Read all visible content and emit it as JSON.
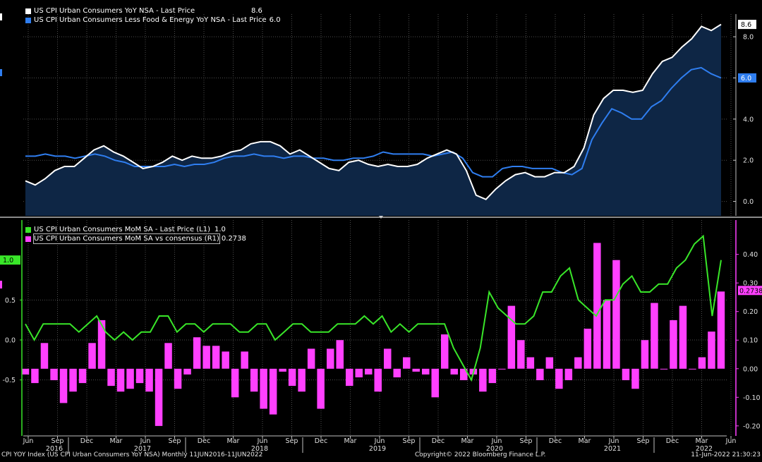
{
  "chart_data": [
    {
      "type": "area",
      "panel": "top",
      "series": [
        {
          "name": "US CPI Urban Consumers YoY NSA - Last Price",
          "last": "8.6",
          "color": "#ffffff",
          "values": [
            1.0,
            0.8,
            1.1,
            1.5,
            1.7,
            1.7,
            2.1,
            2.5,
            2.7,
            2.4,
            2.2,
            1.9,
            1.6,
            1.7,
            1.9,
            2.2,
            2.0,
            2.2,
            2.1,
            2.1,
            2.2,
            2.4,
            2.5,
            2.8,
            2.9,
            2.9,
            2.7,
            2.3,
            2.5,
            2.2,
            1.9,
            1.6,
            1.5,
            1.9,
            2.0,
            1.8,
            1.7,
            1.8,
            1.7,
            1.7,
            1.8,
            2.1,
            2.3,
            2.5,
            2.3,
            1.5,
            0.3,
            0.1,
            0.6,
            1.0,
            1.3,
            1.4,
            1.2,
            1.2,
            1.4,
            1.4,
            1.7,
            2.6,
            4.2,
            5.0,
            5.4,
            5.4,
            5.3,
            5.4,
            6.2,
            6.8,
            7.0,
            7.5,
            7.9,
            8.5,
            8.3,
            8.6
          ]
        },
        {
          "name": "US CPI Urban Consumers Less Food & Energy YoY NSA - Last Price",
          "last": "6.0",
          "color": "#2f7ef0",
          "values": [
            2.2,
            2.2,
            2.3,
            2.2,
            2.2,
            2.1,
            2.2,
            2.3,
            2.2,
            2.0,
            1.9,
            1.7,
            1.7,
            1.7,
            1.7,
            1.8,
            1.7,
            1.8,
            1.8,
            1.9,
            2.1,
            2.2,
            2.2,
            2.3,
            2.2,
            2.2,
            2.1,
            2.2,
            2.2,
            2.1,
            2.1,
            2.0,
            2.0,
            2.1,
            2.1,
            2.2,
            2.4,
            2.3,
            2.3,
            2.3,
            2.3,
            2.2,
            2.3,
            2.4,
            2.1,
            1.4,
            1.2,
            1.2,
            1.6,
            1.7,
            1.7,
            1.6,
            1.6,
            1.6,
            1.4,
            1.3,
            1.6,
            3.0,
            3.8,
            4.5,
            4.3,
            4.0,
            4.0,
            4.6,
            4.9,
            5.5,
            6.0,
            6.4,
            6.5,
            6.2,
            6.0
          ]
        }
      ],
      "y_ticks": [
        "0.0",
        "2.0",
        "4.0",
        "6.0",
        "8.0"
      ],
      "ylim": [
        -0.7,
        9.1
      ]
    },
    {
      "type": "bar",
      "panel": "bottom",
      "series": [
        {
          "name": "US CPI Urban Consumers MoM SA - Last Price (L1)",
          "last": "1.0",
          "color": "#39e629",
          "values": [
            0.2,
            0.0,
            0.2,
            0.2,
            0.2,
            0.2,
            0.1,
            0.2,
            0.3,
            0.1,
            0.0,
            0.1,
            0.0,
            0.1,
            0.1,
            0.3,
            0.3,
            0.1,
            0.2,
            0.2,
            0.1,
            0.2,
            0.2,
            0.2,
            0.1,
            0.1,
            0.2,
            0.2,
            0.0,
            0.1,
            0.2,
            0.2,
            0.1,
            0.1,
            0.1,
            0.2,
            0.2,
            0.2,
            0.3,
            0.2,
            0.3,
            0.1,
            0.2,
            0.1,
            0.2,
            0.2,
            0.2,
            0.2,
            -0.1,
            -0.3,
            -0.5,
            -0.1,
            0.6,
            0.4,
            0.3,
            0.2,
            0.2,
            0.3,
            0.6,
            0.6,
            0.8,
            0.9,
            0.5,
            0.4,
            0.3,
            0.5,
            0.5,
            0.7,
            0.8,
            0.6,
            0.6,
            0.7,
            0.7,
            0.9,
            1.0,
            1.2,
            1.3,
            0.3,
            1.0
          ]
        },
        {
          "name": "US CPI Urban Consumers MoM SA vs consensus (R1)",
          "last": "0.2738",
          "color": "#ff40ff",
          "values": [
            -0.02,
            -0.05,
            0.09,
            -0.04,
            -0.12,
            -0.08,
            -0.05,
            0.09,
            0.17,
            -0.06,
            -0.08,
            -0.07,
            -0.05,
            -0.08,
            -0.2,
            0.09,
            -0.07,
            -0.02,
            0.11,
            0.08,
            0.08,
            0.06,
            -0.1,
            0.06,
            -0.08,
            -0.14,
            -0.16,
            -0.01,
            -0.06,
            -0.08,
            0.07,
            -0.14,
            0.07,
            0.1,
            -0.06,
            -0.03,
            -0.02,
            -0.08,
            0.07,
            -0.03,
            0.04,
            -0.01,
            -0.02,
            -0.1,
            0.12,
            -0.02,
            -0.04,
            -0.02,
            -0.08,
            -0.05,
            0.0,
            0.22,
            0.1,
            0.04,
            -0.04,
            0.04,
            -0.07,
            -0.04,
            0.04,
            0.14,
            0.44,
            0.24,
            0.38,
            -0.04,
            -0.07,
            0.1,
            0.23,
            0.0,
            0.17,
            0.22,
            0.0,
            0.04,
            0.13,
            0.27
          ]
        }
      ],
      "left_ticks": [
        "0.5",
        "0.0",
        "-0.5"
      ],
      "right_ticks": [
        "0.40",
        "0.30",
        "0.20",
        "0.10",
        "0.00",
        "-0.10",
        "-0.20"
      ],
      "left_ylim": [
        -1.2,
        1.5
      ],
      "right_ylim": [
        -0.235,
        0.52
      ]
    }
  ],
  "x_axis": {
    "months": [
      "Jun",
      "Sep",
      "Dec",
      "Mar",
      "Jun",
      "Sep",
      "Dec",
      "Mar",
      "Jun",
      "Sep",
      "Dec",
      "Mar",
      "Jun",
      "Sep",
      "Dec",
      "Mar",
      "Jun",
      "Sep",
      "Dec",
      "Mar",
      "Jun",
      "Sep",
      "Dec",
      "Mar",
      "Jun"
    ],
    "years": [
      "2016",
      "2017",
      "2018",
      "2019",
      "2020",
      "2021",
      "2022"
    ]
  },
  "colors": {
    "background": "#000000",
    "grid": "#4d4d4d",
    "area_fill": "#0e2645",
    "divider": "#8a8a8a"
  },
  "footer": {
    "left": "CPI YOY Index (US CPI Urban Consumers YoY NSA)  Monthly 11JUN2016-11JUN2022",
    "center": "Copyright© 2022 Bloomberg Finance L.P.",
    "right": "11-Jun-2022 21:30:23"
  }
}
